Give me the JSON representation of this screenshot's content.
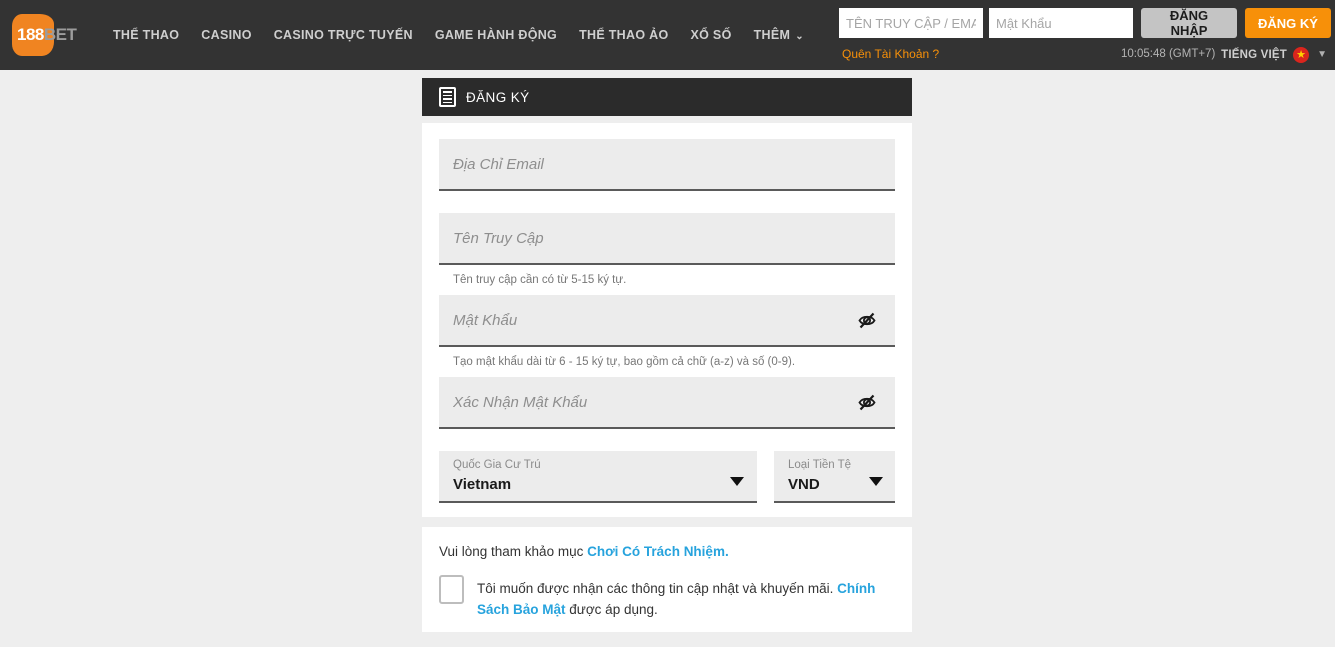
{
  "brand": {
    "logo_primary": "188",
    "logo_secondary": "BET",
    "accent_orange": "#f79009",
    "link_blue": "#27a3dd",
    "header_dark": "#333333"
  },
  "nav": {
    "items": [
      {
        "label": "THỂ THAO"
      },
      {
        "label": "CASINO"
      },
      {
        "label": "CASINO TRỰC TUYẾN"
      },
      {
        "label": "GAME HÀNH ĐỘNG"
      },
      {
        "label": "THỂ THAO ẢO"
      },
      {
        "label": "XỔ SỐ"
      },
      {
        "label": "THÊM"
      }
    ],
    "more_chevron": "⌄"
  },
  "login": {
    "username_placeholder": "TÊN TRUY CẬP / EMAIL",
    "username_value": "",
    "password_placeholder": "Mật Khẩu",
    "password_value": "",
    "login_label": "ĐĂNG NHẬP",
    "register_label": "ĐĂNG KÝ",
    "forgot_label": "Quên Tài Khoản ?",
    "clock": "10:05:48 (GMT+7)",
    "language": "TIẾNG VIỆT",
    "flag_icon": "★",
    "lang_chevron": "▼"
  },
  "register": {
    "header_title": "ĐĂNG KÝ",
    "header_icon": "document-icon",
    "fields": {
      "email": {
        "placeholder": "Địa Chỉ Email",
        "value": ""
      },
      "username": {
        "placeholder": "Tên Truy Cập",
        "value": "",
        "hint": "Tên truy cập cần có từ 5-15 ký tự."
      },
      "password": {
        "placeholder": "Mật Khẩu",
        "value": "",
        "hint": "Tạo mật khẩu dài từ 6 - 15 ký tự, bao gồm cả chữ (a-z) và số (0-9)."
      },
      "confirm_password": {
        "placeholder": "Xác Nhận Mật Khẩu",
        "value": ""
      }
    },
    "country": {
      "label": "Quốc Gia Cư Trú",
      "value": "Vietnam"
    },
    "currency": {
      "label": "Loại Tiền Tệ",
      "value": "VND"
    }
  },
  "terms": {
    "responsible_prefix": "Vui lòng tham khảo mục ",
    "responsible_link": "Chơi Có Trách Nhiệm.",
    "consent_part1": "Tôi muốn được nhận các thông tin cập nhật và khuyến mãi. ",
    "consent_link": "Chính Sách Bảo Mật",
    "consent_part2": " được áp dụng.",
    "checkbox_checked": false
  }
}
